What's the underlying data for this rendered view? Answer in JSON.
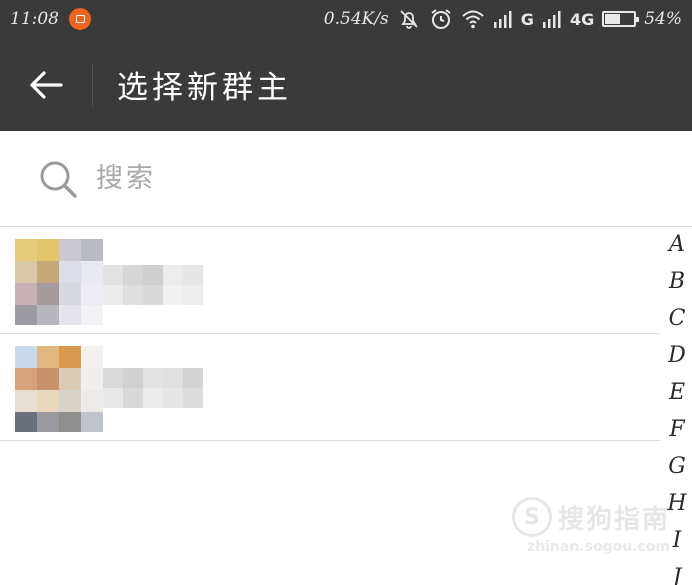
{
  "status_bar": {
    "time": "11:08",
    "speed": "0.54K/s",
    "network_g": "G",
    "network_4g": "4G",
    "battery_percent": "54%",
    "battery_level": 0.54
  },
  "header": {
    "title": "选择新群主"
  },
  "search": {
    "placeholder": "搜索"
  },
  "members": [
    {
      "name": ""
    },
    {
      "name": ""
    }
  ],
  "index_bar": [
    "A",
    "B",
    "C",
    "D",
    "E",
    "F",
    "G",
    "H",
    "I",
    "J"
  ],
  "watermark": {
    "text": "搜狗指南",
    "url": "zhinan.sogou.com"
  }
}
